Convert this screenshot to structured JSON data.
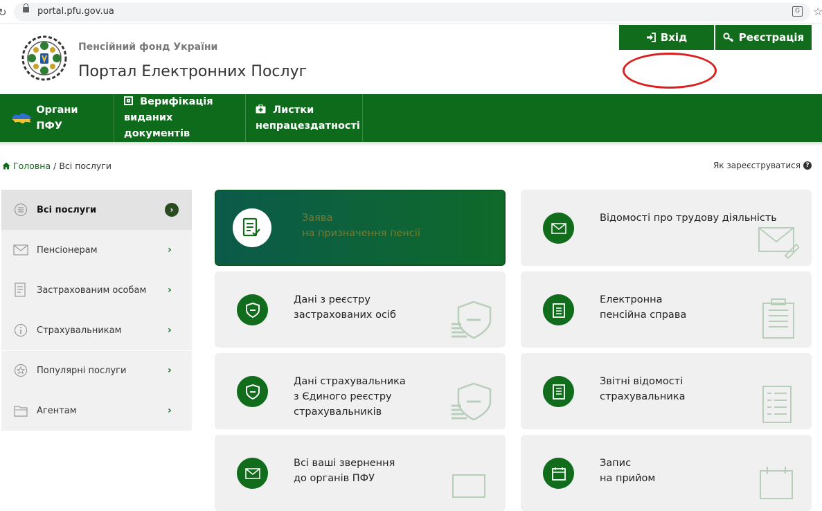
{
  "browser": {
    "url": "portal.pfu.gov.ua"
  },
  "header": {
    "org_name": "Пенсійний фонд України",
    "portal_name": "Портал Електронних Послуг",
    "login_label": "Вхід",
    "register_label": "Реєстрація"
  },
  "nav": {
    "items": [
      {
        "label": "Органи ПФУ"
      },
      {
        "label_line1": "Верифікація",
        "label_line2": "виданих документів"
      },
      {
        "label_line1": "Листки",
        "label_line2": "непрацездатності"
      }
    ]
  },
  "breadcrumb": {
    "home": "Головна",
    "separator": "/",
    "current": "Всі послуги"
  },
  "help": {
    "how_register": "Як зареєструватися"
  },
  "sidebar": {
    "items": [
      {
        "label": "Всі послуги",
        "icon": "list-circle-icon",
        "active": true
      },
      {
        "label": "Пенсіонерам",
        "icon": "envelope-icon"
      },
      {
        "label": "Застрахованим особам",
        "icon": "document-edit-icon"
      },
      {
        "label": "Страхувальникам",
        "icon": "info-icon"
      },
      {
        "label": "Популярні послуги",
        "icon": "star-badge-icon"
      },
      {
        "label": "Агентам",
        "icon": "folder-icon"
      }
    ]
  },
  "cards": [
    {
      "line1": "Заява",
      "line2": "на призначення пенсії",
      "line3": "",
      "icon": "application-form-icon"
    },
    {
      "line1": "Відомості про трудову діяльність",
      "line2": "",
      "line3": "",
      "icon": "envelope-edit-icon"
    },
    {
      "line1": "Дані з реєстру",
      "line2": "застрахованих осіб",
      "line3": "",
      "icon": "shield-minus-icon"
    },
    {
      "line1": "Електронна",
      "line2": "пенсійна справа",
      "line3": "",
      "icon": "clipboard-icon"
    },
    {
      "line1": "Дані страхувальника",
      "line2": "з Єдиного реєстру",
      "line3": "страхувальників",
      "icon": "shield-minus-icon"
    },
    {
      "line1": "Звітні відомості",
      "line2": "страхувальника",
      "line3": "",
      "icon": "report-list-icon"
    },
    {
      "line1": "Всі ваші звернення",
      "line2": "до органів ПФУ",
      "line3": "",
      "icon": "mail-icon"
    },
    {
      "line1": "Запис",
      "line2": "на прийом",
      "line3": "",
      "icon": "calendar-icon"
    }
  ],
  "colors": {
    "brand_green": "#116c1c",
    "annotation_red": "#d9201f"
  }
}
